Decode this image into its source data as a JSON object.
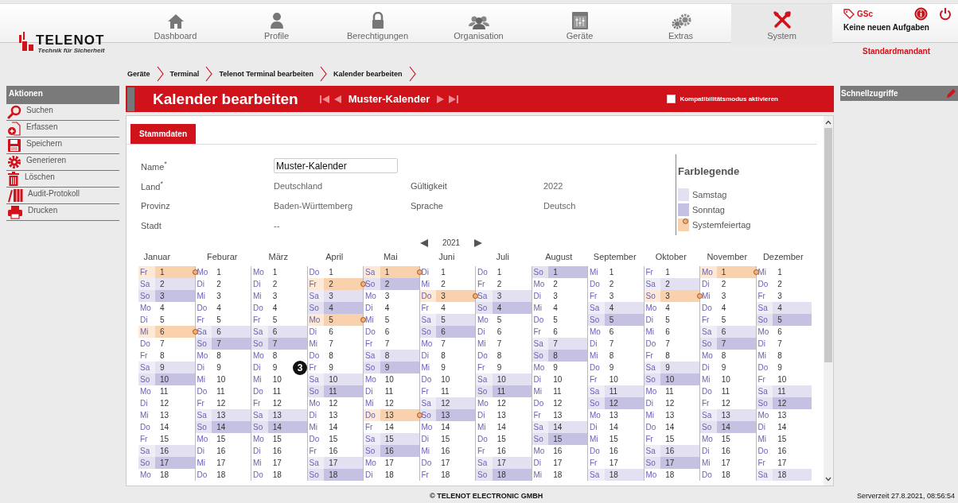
{
  "logo": {
    "brand": "TELENOT",
    "tagline": "Technik für Sicherheit"
  },
  "nav": [
    {
      "label": "Dashboard",
      "selected": false
    },
    {
      "label": "Profile",
      "selected": false
    },
    {
      "label": "Berechtigungen",
      "selected": false
    },
    {
      "label": "Organisation",
      "selected": false
    },
    {
      "label": "Geräte",
      "selected": false
    },
    {
      "label": "Extras",
      "selected": false
    },
    {
      "label": "System",
      "selected": true
    }
  ],
  "user": {
    "initials": "GSc",
    "tasks": "Keine neuen Aufgaben",
    "tenant": "Standardmandant"
  },
  "breadcrumb": [
    "Geräte",
    "Terminal",
    "Telenot Terminal bearbeiten",
    "Kalender bearbeiten"
  ],
  "actions": {
    "title": "Aktionen",
    "items": [
      {
        "label": "Suchen"
      },
      {
        "label": "Erfassen"
      },
      {
        "label": "Speichern"
      },
      {
        "label": "Generieren"
      },
      {
        "label": "Löschen"
      },
      {
        "label": "Audit-Protokoll"
      },
      {
        "label": "Drucken"
      }
    ]
  },
  "page": {
    "title": "Kalender bearbeiten",
    "record": "Muster-Kalender",
    "compat": {
      "label": "Kompatibilitätsmodus aktivieren",
      "checked": false
    }
  },
  "quick_access": {
    "title": "Schnellzugriffe"
  },
  "tabs": [
    {
      "label": "Stammdaten",
      "selected": true
    }
  ],
  "form": {
    "left": [
      {
        "label": "Name$^{*}$",
        "value": "Muster-Kalender",
        "kind": "input"
      },
      {
        "label": "Land$^{*}$",
        "value": "Deutschland",
        "kind": "text"
      },
      {
        "label": "Provinz",
        "value": "Baden-Württemberg",
        "kind": "text"
      },
      {
        "label": "Stadt",
        "value": "--",
        "kind": "text"
      }
    ],
    "right": [
      {
        "label": "Gültigkeit",
        "value": "2022"
      },
      {
        "label": "Sprache",
        "value": "Deutsch"
      }
    ]
  },
  "legend": {
    "title": "Farblegende",
    "items": [
      {
        "label": "Samstag",
        "kind": "saturday"
      },
      {
        "label": "Sonntag",
        "kind": "sunday"
      },
      {
        "label": "Systemfeiertag",
        "kind": "holiday"
      }
    ]
  },
  "calendar": {
    "year": "2021",
    "months": [
      {
        "name": "Januar",
        "days": [
          {
            "wd": "Fr",
            "day": "1",
            "kind": "holiday"
          },
          {
            "wd": "Sa",
            "day": "2",
            "kind": "saturday"
          },
          {
            "wd": "So",
            "day": "3",
            "kind": "sunday"
          },
          {
            "wd": "Mo",
            "day": "4",
            "kind": "weekday"
          },
          {
            "wd": "Di",
            "day": "5",
            "kind": "weekday"
          },
          {
            "wd": "Mi",
            "day": "6",
            "kind": "holiday"
          },
          {
            "wd": "Do",
            "day": "7",
            "kind": "weekday"
          },
          {
            "wd": "Fr",
            "day": "8",
            "kind": "weekday"
          },
          {
            "wd": "Sa",
            "day": "9",
            "kind": "saturday"
          },
          {
            "wd": "So",
            "day": "10",
            "kind": "sunday"
          },
          {
            "wd": "Mo",
            "day": "11",
            "kind": "weekday"
          },
          {
            "wd": "Di",
            "day": "12",
            "kind": "weekday"
          },
          {
            "wd": "Mi",
            "day": "13",
            "kind": "weekday"
          },
          {
            "wd": "Do",
            "day": "14",
            "kind": "weekday"
          },
          {
            "wd": "Fr",
            "day": "15",
            "kind": "weekday"
          },
          {
            "wd": "Sa",
            "day": "16",
            "kind": "saturday"
          },
          {
            "wd": "So",
            "day": "17",
            "kind": "sunday"
          },
          {
            "wd": "Mo",
            "day": "18",
            "kind": "weekday"
          }
        ]
      },
      {
        "name": "Feburar",
        "days": [
          {
            "wd": "Mo",
            "day": "1",
            "kind": "weekday"
          },
          {
            "wd": "Di",
            "day": "2",
            "kind": "weekday"
          },
          {
            "wd": "Mi",
            "day": "3",
            "kind": "weekday"
          },
          {
            "wd": "Do",
            "day": "4",
            "kind": "weekday"
          },
          {
            "wd": "Fr",
            "day": "5",
            "kind": "weekday"
          },
          {
            "wd": "Sa",
            "day": "6",
            "kind": "saturday"
          },
          {
            "wd": "So",
            "day": "7",
            "kind": "sunday"
          },
          {
            "wd": "Mo",
            "day": "8",
            "kind": "weekday"
          },
          {
            "wd": "Di",
            "day": "9",
            "kind": "weekday"
          },
          {
            "wd": "Mi",
            "day": "10",
            "kind": "weekday"
          },
          {
            "wd": "Do",
            "day": "11",
            "kind": "weekday"
          },
          {
            "wd": "Fr",
            "day": "12",
            "kind": "weekday"
          },
          {
            "wd": "Sa",
            "day": "13",
            "kind": "saturday"
          },
          {
            "wd": "So",
            "day": "14",
            "kind": "sunday"
          },
          {
            "wd": "Mo",
            "day": "15",
            "kind": "weekday"
          },
          {
            "wd": "Di",
            "day": "16",
            "kind": "weekday"
          },
          {
            "wd": "Mi",
            "day": "17",
            "kind": "weekday"
          },
          {
            "wd": "Do",
            "day": "18",
            "kind": "weekday"
          }
        ]
      },
      {
        "name": "März",
        "days": [
          {
            "wd": "Mo",
            "day": "1",
            "kind": "weekday"
          },
          {
            "wd": "Di",
            "day": "2",
            "kind": "weekday"
          },
          {
            "wd": "Mi",
            "day": "3",
            "kind": "weekday"
          },
          {
            "wd": "Do",
            "day": "4",
            "kind": "weekday"
          },
          {
            "wd": "Fr",
            "day": "5",
            "kind": "weekday"
          },
          {
            "wd": "Sa",
            "day": "6",
            "kind": "saturday"
          },
          {
            "wd": "So",
            "day": "7",
            "kind": "sunday"
          },
          {
            "wd": "Mo",
            "day": "8",
            "kind": "weekday"
          },
          {
            "wd": "Di",
            "day": "9",
            "kind": "weekday"
          },
          {
            "wd": "Mi",
            "day": "10",
            "kind": "weekday"
          },
          {
            "wd": "Do",
            "day": "11",
            "kind": "weekday"
          },
          {
            "wd": "Fr",
            "day": "12",
            "kind": "weekday"
          },
          {
            "wd": "Sa",
            "day": "13",
            "kind": "saturday"
          },
          {
            "wd": "So",
            "day": "14",
            "kind": "sunday"
          },
          {
            "wd": "Mo",
            "day": "15",
            "kind": "weekday"
          },
          {
            "wd": "Di",
            "day": "16",
            "kind": "weekday"
          },
          {
            "wd": "Mi",
            "day": "17",
            "kind": "weekday"
          },
          {
            "wd": "Do",
            "day": "18",
            "kind": "weekday"
          }
        ]
      },
      {
        "name": "April",
        "days": [
          {
            "wd": "Do",
            "day": "1",
            "kind": "weekday"
          },
          {
            "wd": "Fr",
            "day": "2",
            "kind": "holiday"
          },
          {
            "wd": "Sa",
            "day": "3",
            "kind": "saturday"
          },
          {
            "wd": "So",
            "day": "4",
            "kind": "sunday"
          },
          {
            "wd": "Mo",
            "day": "5",
            "kind": "holiday"
          },
          {
            "wd": "Di",
            "day": "6",
            "kind": "weekday"
          },
          {
            "wd": "Mi",
            "day": "7",
            "kind": "weekday"
          },
          {
            "wd": "Do",
            "day": "8",
            "kind": "weekday"
          },
          {
            "wd": "Fr",
            "day": "9",
            "kind": "weekday"
          },
          {
            "wd": "Sa",
            "day": "10",
            "kind": "saturday"
          },
          {
            "wd": "So",
            "day": "11",
            "kind": "sunday"
          },
          {
            "wd": "Mo",
            "day": "12",
            "kind": "weekday"
          },
          {
            "wd": "Di",
            "day": "13",
            "kind": "weekday"
          },
          {
            "wd": "Mi",
            "day": "14",
            "kind": "weekday"
          },
          {
            "wd": "Do",
            "day": "15",
            "kind": "weekday"
          },
          {
            "wd": "Fr",
            "day": "16",
            "kind": "weekday"
          },
          {
            "wd": "Sa",
            "day": "17",
            "kind": "saturday"
          },
          {
            "wd": "So",
            "day": "18",
            "kind": "sunday"
          }
        ]
      },
      {
        "name": "Mai",
        "days": [
          {
            "wd": "Sa",
            "day": "1",
            "kind": "holiday"
          },
          {
            "wd": "So",
            "day": "2",
            "kind": "sunday"
          },
          {
            "wd": "Mo",
            "day": "3",
            "kind": "weekday"
          },
          {
            "wd": "Di",
            "day": "4",
            "kind": "weekday"
          },
          {
            "wd": "Mi",
            "day": "5",
            "kind": "weekday"
          },
          {
            "wd": "Do",
            "day": "6",
            "kind": "weekday"
          },
          {
            "wd": "Fr",
            "day": "7",
            "kind": "weekday"
          },
          {
            "wd": "Sa",
            "day": "8",
            "kind": "saturday"
          },
          {
            "wd": "So",
            "day": "9",
            "kind": "sunday"
          },
          {
            "wd": "Mo",
            "day": "10",
            "kind": "weekday"
          },
          {
            "wd": "Di",
            "day": "11",
            "kind": "weekday"
          },
          {
            "wd": "Mi",
            "day": "12",
            "kind": "weekday"
          },
          {
            "wd": "Do",
            "day": "13",
            "kind": "holiday"
          },
          {
            "wd": "Fr",
            "day": "14",
            "kind": "weekday"
          },
          {
            "wd": "Sa",
            "day": "15",
            "kind": "saturday"
          },
          {
            "wd": "So",
            "day": "16",
            "kind": "sunday"
          },
          {
            "wd": "Mo",
            "day": "17",
            "kind": "weekday"
          },
          {
            "wd": "Di",
            "day": "18",
            "kind": "weekday"
          }
        ]
      },
      {
        "name": "Juni",
        "days": [
          {
            "wd": "Di",
            "day": "1",
            "kind": "weekday"
          },
          {
            "wd": "Mi",
            "day": "2",
            "kind": "weekday"
          },
          {
            "wd": "Do",
            "day": "3",
            "kind": "holiday"
          },
          {
            "wd": "Fr",
            "day": "4",
            "kind": "weekday"
          },
          {
            "wd": "Sa",
            "day": "5",
            "kind": "saturday"
          },
          {
            "wd": "So",
            "day": "6",
            "kind": "sunday"
          },
          {
            "wd": "Mo",
            "day": "7",
            "kind": "weekday"
          },
          {
            "wd": "Di",
            "day": "8",
            "kind": "weekday"
          },
          {
            "wd": "Mi",
            "day": "9",
            "kind": "weekday"
          },
          {
            "wd": "Do",
            "day": "10",
            "kind": "weekday"
          },
          {
            "wd": "Fr",
            "day": "11",
            "kind": "weekday"
          },
          {
            "wd": "Sa",
            "day": "12",
            "kind": "saturday"
          },
          {
            "wd": "So",
            "day": "13",
            "kind": "sunday"
          },
          {
            "wd": "Mo",
            "day": "14",
            "kind": "weekday"
          },
          {
            "wd": "Di",
            "day": "15",
            "kind": "weekday"
          },
          {
            "wd": "Mi",
            "day": "16",
            "kind": "weekday"
          },
          {
            "wd": "Do",
            "day": "17",
            "kind": "weekday"
          },
          {
            "wd": "Fr",
            "day": "18",
            "kind": "weekday"
          }
        ]
      },
      {
        "name": "Juli",
        "days": [
          {
            "wd": "Do",
            "day": "1",
            "kind": "weekday"
          },
          {
            "wd": "Fr",
            "day": "2",
            "kind": "weekday"
          },
          {
            "wd": "Sa",
            "day": "3",
            "kind": "saturday"
          },
          {
            "wd": "So",
            "day": "4",
            "kind": "sunday"
          },
          {
            "wd": "Mo",
            "day": "5",
            "kind": "weekday"
          },
          {
            "wd": "Di",
            "day": "6",
            "kind": "weekday"
          },
          {
            "wd": "Mi",
            "day": "7",
            "kind": "weekday"
          },
          {
            "wd": "Do",
            "day": "8",
            "kind": "weekday"
          },
          {
            "wd": "Fr",
            "day": "9",
            "kind": "weekday"
          },
          {
            "wd": "Sa",
            "day": "10",
            "kind": "saturday"
          },
          {
            "wd": "So",
            "day": "11",
            "kind": "sunday"
          },
          {
            "wd": "Mo",
            "day": "12",
            "kind": "weekday"
          },
          {
            "wd": "Di",
            "day": "13",
            "kind": "weekday"
          },
          {
            "wd": "Mi",
            "day": "14",
            "kind": "weekday"
          },
          {
            "wd": "Do",
            "day": "15",
            "kind": "weekday"
          },
          {
            "wd": "Fr",
            "day": "16",
            "kind": "weekday"
          },
          {
            "wd": "Sa",
            "day": "17",
            "kind": "saturday"
          },
          {
            "wd": "So",
            "day": "18",
            "kind": "sunday"
          }
        ]
      },
      {
        "name": "August",
        "days": [
          {
            "wd": "So",
            "day": "1",
            "kind": "sunday"
          },
          {
            "wd": "Mo",
            "day": "2",
            "kind": "weekday"
          },
          {
            "wd": "Di",
            "day": "3",
            "kind": "weekday"
          },
          {
            "wd": "Mi",
            "day": "4",
            "kind": "weekday"
          },
          {
            "wd": "Do",
            "day": "5",
            "kind": "weekday"
          },
          {
            "wd": "Fr",
            "day": "6",
            "kind": "weekday"
          },
          {
            "wd": "Sa",
            "day": "7",
            "kind": "saturday"
          },
          {
            "wd": "So",
            "day": "8",
            "kind": "sunday"
          },
          {
            "wd": "Mo",
            "day": "9",
            "kind": "weekday"
          },
          {
            "wd": "Di",
            "day": "10",
            "kind": "weekday"
          },
          {
            "wd": "Mi",
            "day": "11",
            "kind": "weekday"
          },
          {
            "wd": "Do",
            "day": "12",
            "kind": "weekday"
          },
          {
            "wd": "Fr",
            "day": "13",
            "kind": "weekday"
          },
          {
            "wd": "Sa",
            "day": "14",
            "kind": "saturday"
          },
          {
            "wd": "So",
            "day": "15",
            "kind": "sunday"
          },
          {
            "wd": "Mo",
            "day": "16",
            "kind": "weekday"
          },
          {
            "wd": "Di",
            "day": "17",
            "kind": "weekday"
          },
          {
            "wd": "Mi",
            "day": "18",
            "kind": "weekday"
          }
        ]
      },
      {
        "name": "September",
        "days": [
          {
            "wd": "Mi",
            "day": "1",
            "kind": "weekday"
          },
          {
            "wd": "Do",
            "day": "2",
            "kind": "weekday"
          },
          {
            "wd": "Fr",
            "day": "3",
            "kind": "weekday"
          },
          {
            "wd": "Sa",
            "day": "4",
            "kind": "saturday"
          },
          {
            "wd": "So",
            "day": "5",
            "kind": "sunday"
          },
          {
            "wd": "Mo",
            "day": "6",
            "kind": "weekday"
          },
          {
            "wd": "Di",
            "day": "7",
            "kind": "weekday"
          },
          {
            "wd": "Mi",
            "day": "8",
            "kind": "weekday"
          },
          {
            "wd": "Do",
            "day": "9",
            "kind": "weekday"
          },
          {
            "wd": "Fr",
            "day": "10",
            "kind": "weekday"
          },
          {
            "wd": "Sa",
            "day": "11",
            "kind": "saturday"
          },
          {
            "wd": "So",
            "day": "12",
            "kind": "sunday"
          },
          {
            "wd": "Mo",
            "day": "13",
            "kind": "weekday"
          },
          {
            "wd": "Di",
            "day": "14",
            "kind": "weekday"
          },
          {
            "wd": "Mi",
            "day": "15",
            "kind": "weekday"
          },
          {
            "wd": "Do",
            "day": "16",
            "kind": "weekday"
          },
          {
            "wd": "Fr",
            "day": "17",
            "kind": "weekday"
          },
          {
            "wd": "Sa",
            "day": "18",
            "kind": "saturday"
          }
        ]
      },
      {
        "name": "Oktober",
        "days": [
          {
            "wd": "Fr",
            "day": "1",
            "kind": "weekday"
          },
          {
            "wd": "Sa",
            "day": "2",
            "kind": "saturday"
          },
          {
            "wd": "So",
            "day": "3",
            "kind": "holiday"
          },
          {
            "wd": "Mo",
            "day": "4",
            "kind": "weekday"
          },
          {
            "wd": "Di",
            "day": "5",
            "kind": "weekday"
          },
          {
            "wd": "Mi",
            "day": "6",
            "kind": "weekday"
          },
          {
            "wd": "Do",
            "day": "7",
            "kind": "weekday"
          },
          {
            "wd": "Fr",
            "day": "8",
            "kind": "weekday"
          },
          {
            "wd": "Sa",
            "day": "9",
            "kind": "saturday"
          },
          {
            "wd": "So",
            "day": "10",
            "kind": "sunday"
          },
          {
            "wd": "Mo",
            "day": "11",
            "kind": "weekday"
          },
          {
            "wd": "Di",
            "day": "12",
            "kind": "weekday"
          },
          {
            "wd": "Mi",
            "day": "13",
            "kind": "weekday"
          },
          {
            "wd": "Do",
            "day": "14",
            "kind": "weekday"
          },
          {
            "wd": "Fr",
            "day": "15",
            "kind": "weekday"
          },
          {
            "wd": "Sa",
            "day": "16",
            "kind": "saturday"
          },
          {
            "wd": "So",
            "day": "17",
            "kind": "sunday"
          },
          {
            "wd": "Mo",
            "day": "18",
            "kind": "weekday"
          }
        ]
      },
      {
        "name": "November",
        "days": [
          {
            "wd": "Mo",
            "day": "1",
            "kind": "holiday"
          },
          {
            "wd": "Di",
            "day": "2",
            "kind": "weekday"
          },
          {
            "wd": "Mi",
            "day": "3",
            "kind": "weekday"
          },
          {
            "wd": "Do",
            "day": "4",
            "kind": "weekday"
          },
          {
            "wd": "Fr",
            "day": "5",
            "kind": "weekday"
          },
          {
            "wd": "Sa",
            "day": "6",
            "kind": "saturday"
          },
          {
            "wd": "So",
            "day": "7",
            "kind": "sunday"
          },
          {
            "wd": "Mo",
            "day": "8",
            "kind": "weekday"
          },
          {
            "wd": "Di",
            "day": "9",
            "kind": "weekday"
          },
          {
            "wd": "Mi",
            "day": "10",
            "kind": "weekday"
          },
          {
            "wd": "Do",
            "day": "11",
            "kind": "weekday"
          },
          {
            "wd": "Fr",
            "day": "12",
            "kind": "weekday"
          },
          {
            "wd": "Sa",
            "day": "13",
            "kind": "saturday"
          },
          {
            "wd": "So",
            "day": "14",
            "kind": "sunday"
          },
          {
            "wd": "Mo",
            "day": "15",
            "kind": "weekday"
          },
          {
            "wd": "Di",
            "day": "16",
            "kind": "weekday"
          },
          {
            "wd": "Mi",
            "day": "17",
            "kind": "weekday"
          },
          {
            "wd": "Do",
            "day": "18",
            "kind": "weekday"
          }
        ]
      },
      {
        "name": "Dezember",
        "days": [
          {
            "wd": "Mi",
            "day": "1",
            "kind": "weekday"
          },
          {
            "wd": "Do",
            "day": "2",
            "kind": "weekday"
          },
          {
            "wd": "Fr",
            "day": "3",
            "kind": "weekday"
          },
          {
            "wd": "Sa",
            "day": "4",
            "kind": "saturday"
          },
          {
            "wd": "So",
            "day": "5",
            "kind": "sunday"
          },
          {
            "wd": "Mo",
            "day": "6",
            "kind": "weekday"
          },
          {
            "wd": "Di",
            "day": "7",
            "kind": "weekday"
          },
          {
            "wd": "Mi",
            "day": "8",
            "kind": "weekday"
          },
          {
            "wd": "Do",
            "day": "9",
            "kind": "weekday"
          },
          {
            "wd": "Fr",
            "day": "10",
            "kind": "weekday"
          },
          {
            "wd": "Sa",
            "day": "11",
            "kind": "saturday"
          },
          {
            "wd": "So",
            "day": "12",
            "kind": "sunday"
          },
          {
            "wd": "Mo",
            "day": "13",
            "kind": "weekday"
          },
          {
            "wd": "Di",
            "day": "14",
            "kind": "weekday"
          },
          {
            "wd": "Mi",
            "day": "15",
            "kind": "weekday"
          },
          {
            "wd": "Do",
            "day": "16",
            "kind": "weekday"
          },
          {
            "wd": "Fr",
            "day": "17",
            "kind": "weekday"
          },
          {
            "wd": "Sa",
            "day": "18",
            "kind": "saturday"
          }
        ]
      }
    ]
  },
  "callout": "3",
  "footer": {
    "copyright": "© TELENOT ELECTRONIC GMBH",
    "server_time": "Serverzeit 27.8.2021, 08:56:54"
  }
}
